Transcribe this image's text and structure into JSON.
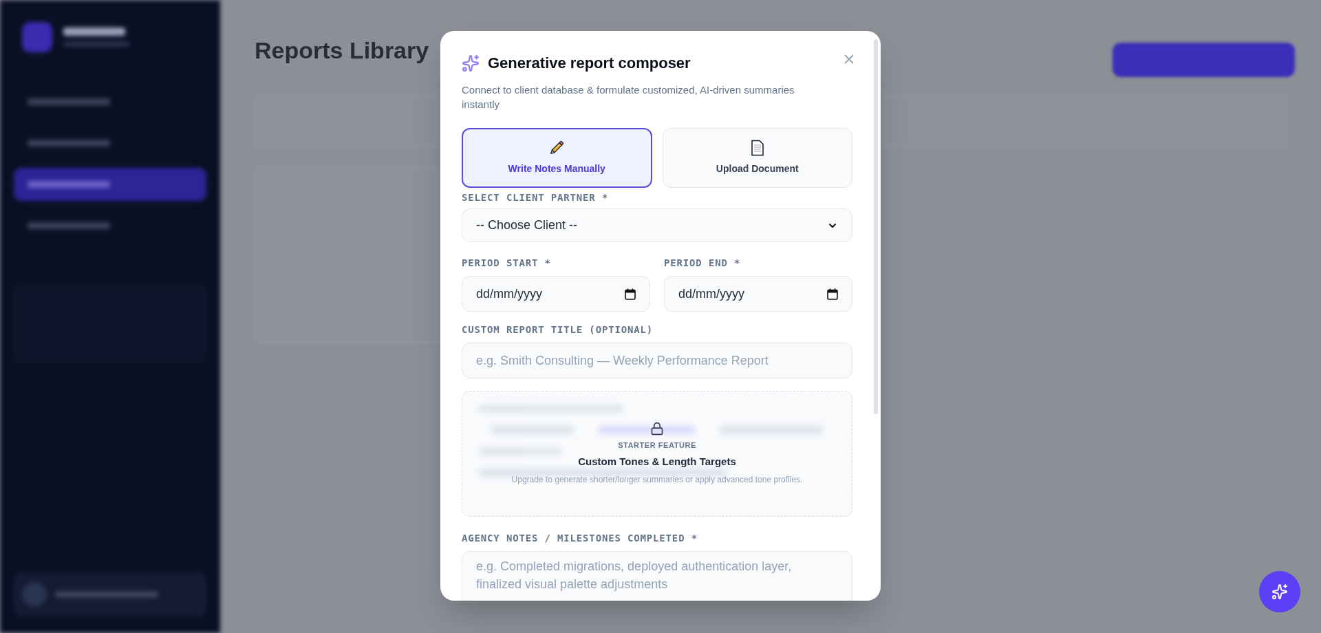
{
  "sidebar": {
    "items": [
      {
        "selected": false
      },
      {
        "selected": false
      },
      {
        "selected": true
      },
      {
        "selected": false
      }
    ]
  },
  "background": {
    "page_title": "Reports Library"
  },
  "modal": {
    "title": "Generative report composer",
    "subtitle": "Connect to client database & formulate customized, AI-driven summaries instantly",
    "modes": [
      {
        "label": "Write Notes Manually",
        "selected": true,
        "kind": "pencil"
      },
      {
        "label": "Upload Document",
        "selected": false,
        "kind": "document"
      }
    ],
    "client": {
      "label": "SELECT CLIENT PARTNER *",
      "value": "-- Choose Client --"
    },
    "period_start": {
      "label": "PERIOD START *",
      "value": "dd/mm/yyyy"
    },
    "period_end": {
      "label": "PERIOD END *",
      "value": "dd/mm/yyyy"
    },
    "report_title": {
      "label": "CUSTOM REPORT TITLE (OPTIONAL)",
      "placeholder": "e.g. Smith Consulting — Weekly Performance Report"
    },
    "locked_feature": {
      "badge": "STARTER FEATURE",
      "title": "Custom Tones & Length Targets",
      "description": "Upgrade to generate shorter/longer summaries or apply advanced tone profiles."
    },
    "notes": {
      "label": "AGENCY NOTES / MILESTONES COMPLETED *",
      "placeholder": "e.g. Completed migrations, deployed authentication layer, finalized visual palette adjustments"
    }
  }
}
